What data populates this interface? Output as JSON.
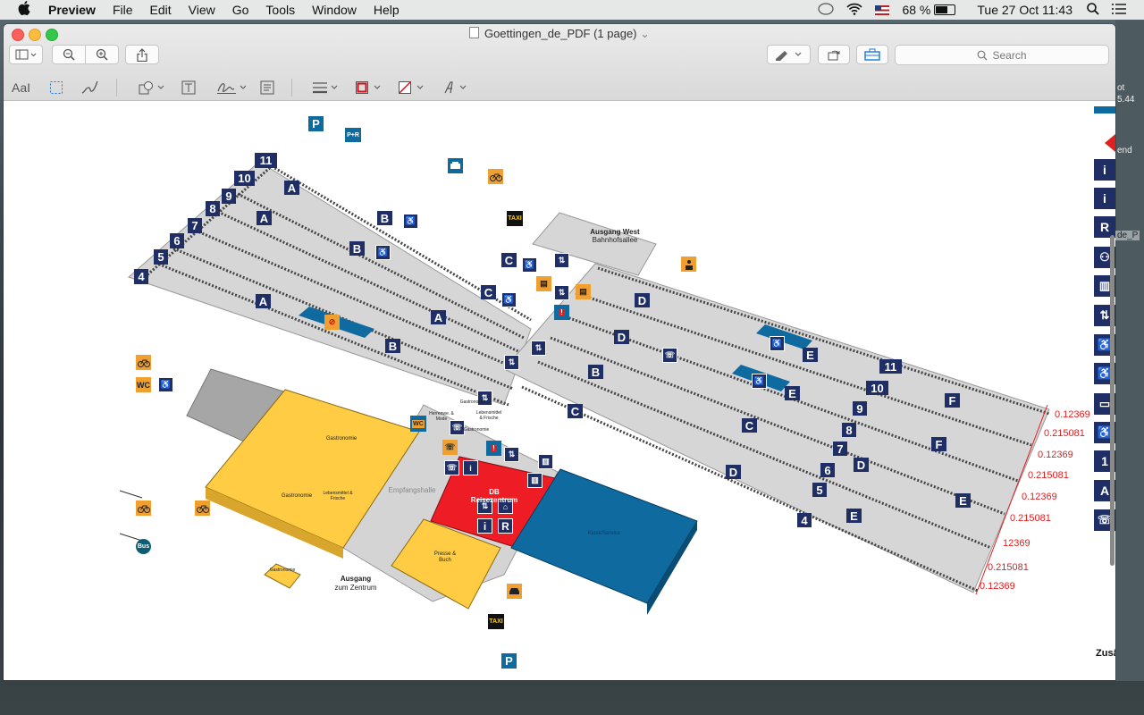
{
  "menubar": {
    "apple": "",
    "app_name": "Preview",
    "items": [
      "File",
      "Edit",
      "View",
      "Go",
      "Tools",
      "Window",
      "Help"
    ],
    "battery_percent": "68 %",
    "datetime": "Tue 27 Oct  11:43"
  },
  "window": {
    "title": "Goettingen_de_PDF (1 page)",
    "title_chevron": "⌄",
    "search_placeholder": "Search",
    "markup": {
      "text_tool": "AaI"
    }
  },
  "map": {
    "labels": {
      "ausgang_west": "Ausgang West",
      "bahnhofsallee": "Bahnhofsallee",
      "gastronomie_big": "Gastronomie",
      "gastronomie_mid": "Gastronomie",
      "lebensmittel": "Lebensmittel & Frische",
      "empfangshalle": "Empfangshalle",
      "db_reisezentrum": "DB Reisezentrum",
      "presse": "Presse & Buch",
      "kiosk_blue": "Kiosk/Service",
      "gastronomie_small": "Gastronomie",
      "ausgang_zentrum_1": "Ausgang",
      "ausgang_zentrum_2": "zum Zentrum",
      "herren_mode": "Herrenwe. & Mode",
      "gastronomie_stair": "Gastronomie",
      "lebensmittel_stair": "Lebensmittel & Frische",
      "gastronomie_stair2": "Gastronomie",
      "wc": "WC",
      "bus": "Bus",
      "taxi": "TAXI",
      "p": "P",
      "pr": "P+R"
    },
    "tracks_west": [
      "11",
      "10",
      "9",
      "8",
      "7",
      "6",
      "5",
      "4"
    ],
    "tracks_east": [
      "11",
      "10",
      "9",
      "8",
      "7",
      "6",
      "5",
      "4"
    ],
    "sectors_west": [
      "A",
      "A",
      "A",
      "B",
      "B",
      "A",
      "B",
      "C",
      "C",
      "B"
    ],
    "sectors_east": [
      "D",
      "D",
      "E",
      "B",
      "E",
      "C",
      "D",
      "C",
      "F",
      "F",
      "E",
      "D",
      "E"
    ]
  },
  "measurements": [
    "0.12369",
    "0.215081",
    "0.12369",
    "0.215081",
    "0.12369",
    "0.215081",
    "12369",
    "0.215081",
    "0.12369"
  ],
  "side_panel": {
    "texts": [
      "ot",
      "5.44",
      "end",
      "de_P",
      "Zusä"
    ]
  },
  "colors": {
    "platform": "#d4d4d4",
    "track_navy": "#1f2f66",
    "gastro_yellow": "#ffcc44",
    "db_red": "#ee1c25",
    "kiosk_blue": "#0f6aa0",
    "meas_red": "#e02020"
  }
}
